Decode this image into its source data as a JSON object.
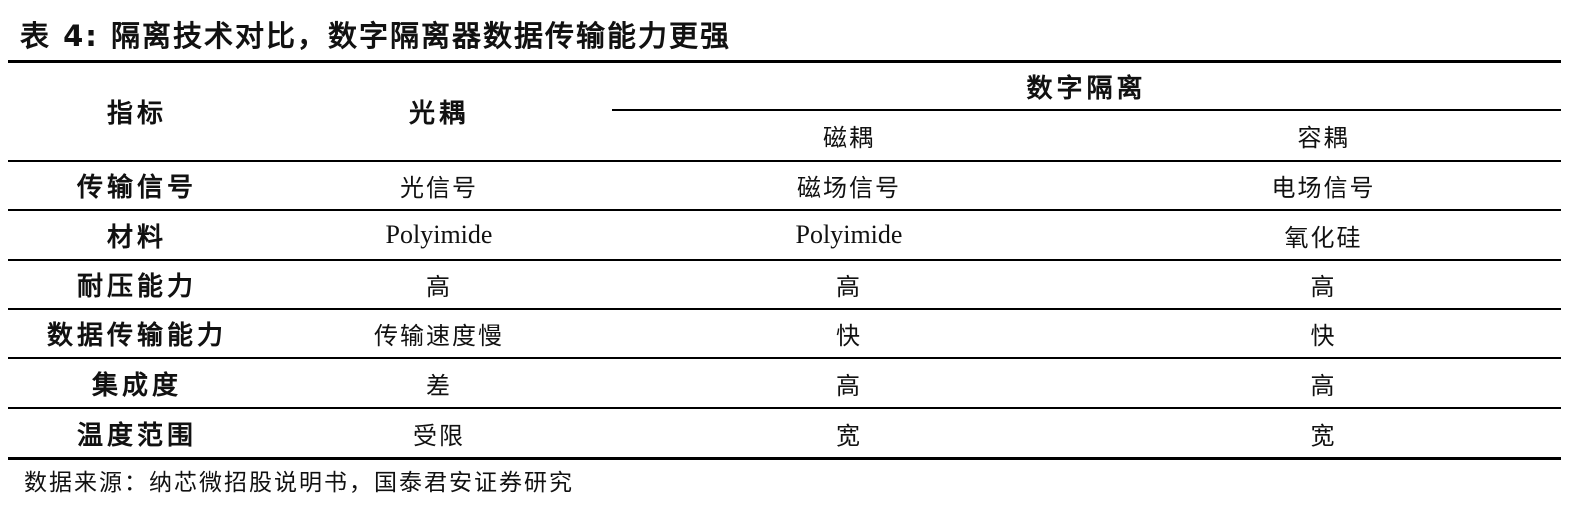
{
  "title": "表 4: 隔离技术对比，数字隔离器数据传输能力更强",
  "table": {
    "header": {
      "indicator": "指标",
      "optical": "光耦",
      "digital_group": "数字隔离",
      "magnetic": "磁耦",
      "capacitive": "容耦"
    },
    "rows": [
      {
        "label": "传输信号",
        "optical": "光信号",
        "magnetic": "磁场信号",
        "capacitive": "电场信号"
      },
      {
        "label": "材料",
        "optical": "Polyimide",
        "magnetic": "Polyimide",
        "capacitive": "氧化硅"
      },
      {
        "label": "耐压能力",
        "optical": "高",
        "magnetic": "高",
        "capacitive": "高"
      },
      {
        "label": "数据传输能力",
        "optical": "传输速度慢",
        "magnetic": "快",
        "capacitive": "快"
      },
      {
        "label": "集成度",
        "optical": "差",
        "magnetic": "高",
        "capacitive": "高"
      },
      {
        "label": "温度范围",
        "optical": "受限",
        "magnetic": "宽",
        "capacitive": "宽"
      }
    ]
  },
  "source": "数据来源：纳芯微招股说明书，国泰君安证券研究"
}
